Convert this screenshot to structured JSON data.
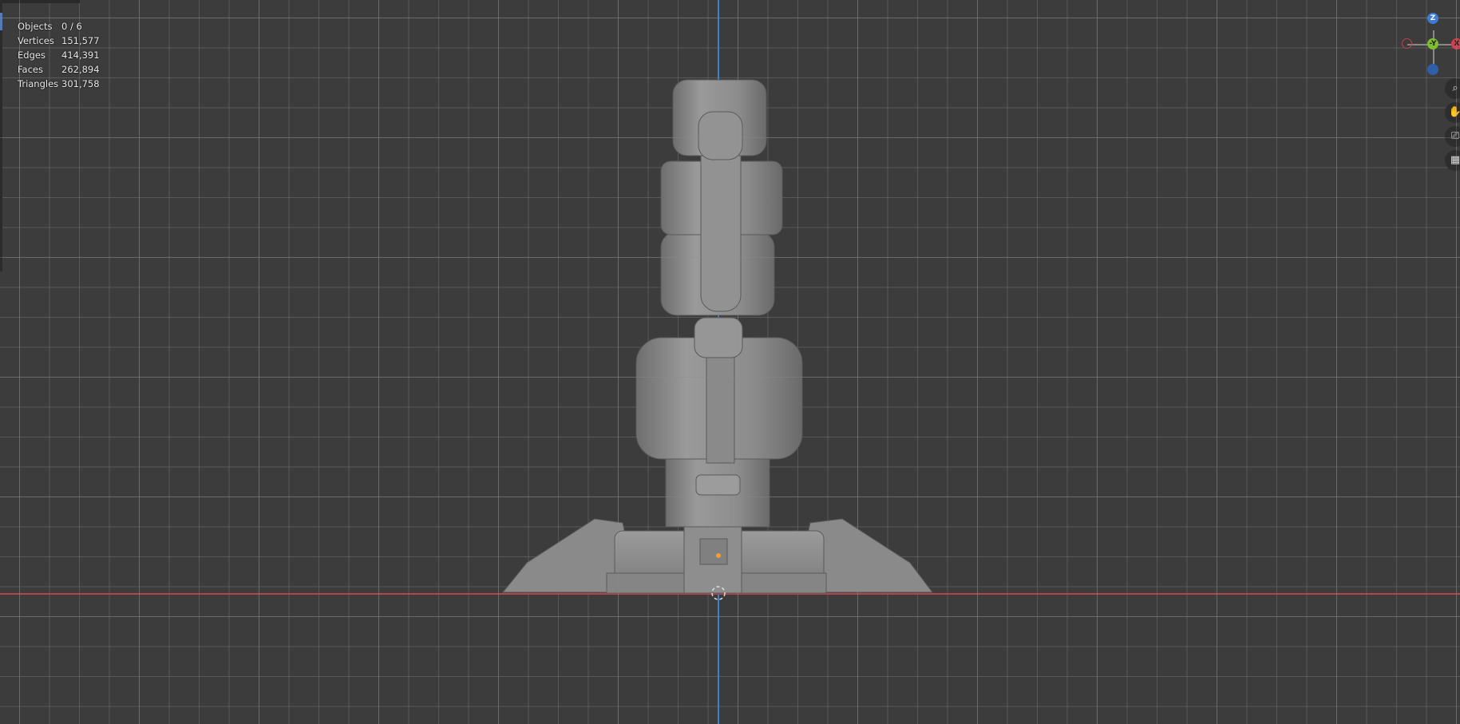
{
  "stats": [
    {
      "label": "Objects",
      "value": "0 / 6"
    },
    {
      "label": "Vertices",
      "value": "151,577"
    },
    {
      "label": "Edges",
      "value": "414,391"
    },
    {
      "label": "Faces",
      "value": "262,894"
    },
    {
      "label": "Triangles",
      "value": "301,758"
    }
  ],
  "gizmo": {
    "z_label": "Z",
    "y_label": "-Y",
    "x_label": "X",
    "colors": {
      "x": "#d0404f",
      "y": "#7fbf2f",
      "z": "#3a7bd5"
    }
  },
  "nav_buttons": [
    "zoom-icon",
    "pan-hand-icon",
    "camera-icon",
    "grid-view-icon"
  ],
  "colors": {
    "background": "#3c3c3c",
    "axis_z": "#3f7fd0",
    "axis_x": "#b04650",
    "model": "#8d8d8d"
  }
}
